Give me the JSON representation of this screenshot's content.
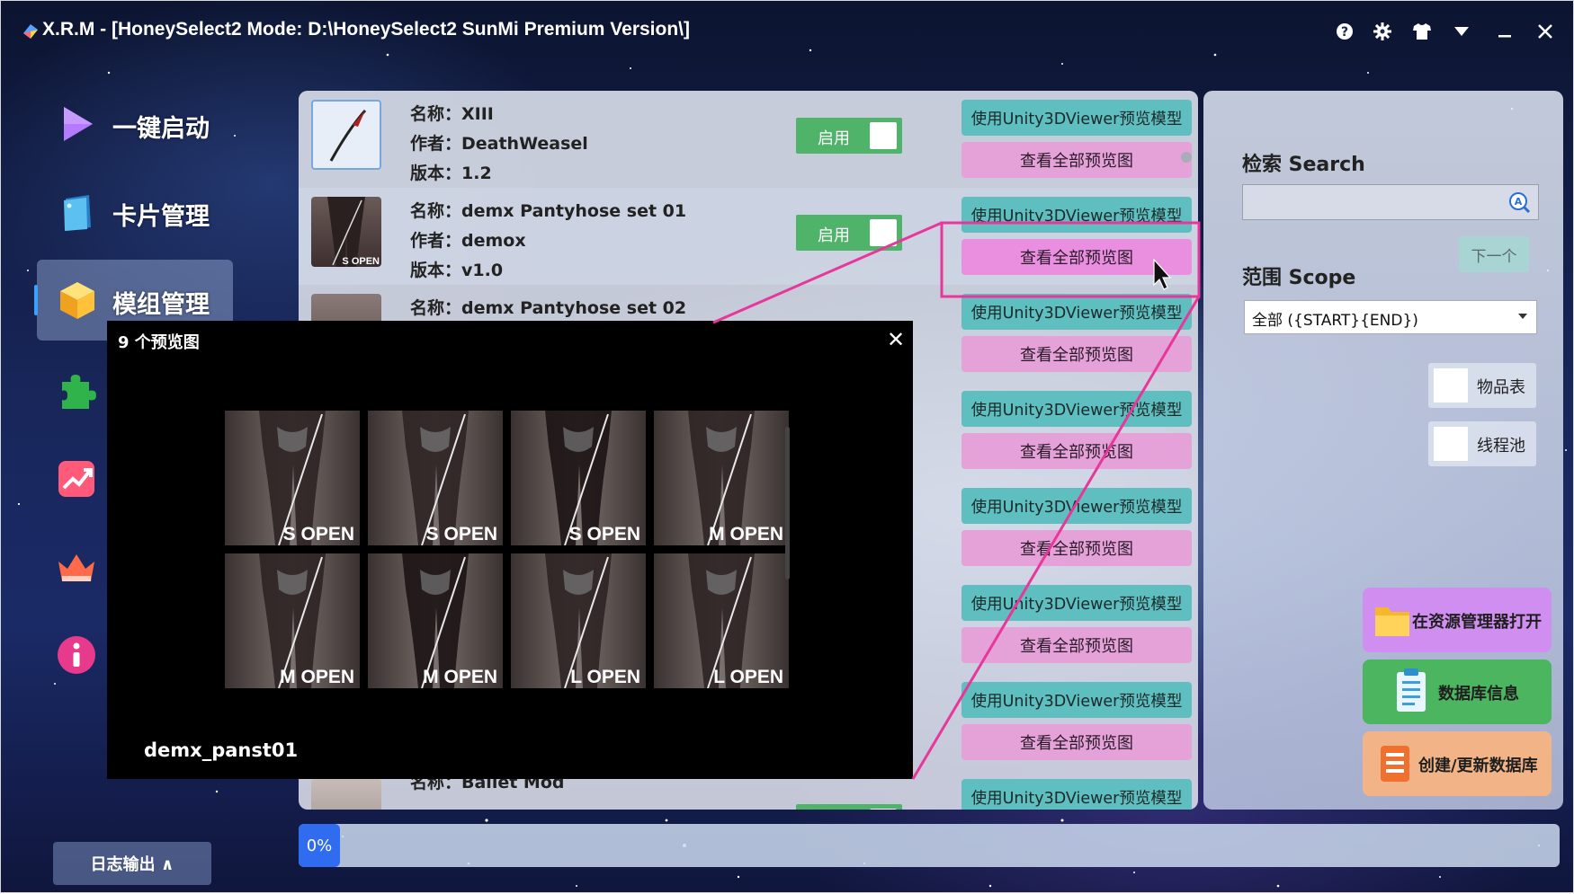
{
  "window": {
    "title": "X.R.M - [HoneySelect2 Mode: D:\\HoneySelect2 SunMi Premium Version\\]"
  },
  "sidebar": {
    "items": [
      {
        "label": "一键启动"
      },
      {
        "label": "卡片管理"
      },
      {
        "label": "模组管理"
      }
    ],
    "log_button": "日志输出 ∧"
  },
  "mods": [
    {
      "name": "名称：XIII",
      "author": "作者：DeathWeasel",
      "version": "版本：1.2",
      "toggle": "启用"
    },
    {
      "name": "名称：demx Pantyhose set 01",
      "author": "作者：demox",
      "version": "版本：v1.0",
      "toggle": "启用"
    },
    {
      "name": "名称：demx Pantyhose set 02",
      "author": "",
      "version": "",
      "toggle": ""
    },
    {
      "name": "名称：Ballet Mod",
      "author": "",
      "version": "",
      "toggle": ""
    }
  ],
  "row_buttons": {
    "unity": "使用Unity3DViewer预览模型",
    "preview": "查看全部预览图"
  },
  "search": {
    "label": "检索 Search",
    "value": "",
    "next": "下一个"
  },
  "scope": {
    "label": "范围 Scope",
    "selected": "全部 ({START}{END})"
  },
  "checkboxes": [
    {
      "label": "物品表",
      "checked": false
    },
    {
      "label": "线程池",
      "checked": false
    }
  ],
  "actions": {
    "open_explorer": "在资源管理器打开",
    "db_info": "数据库信息",
    "create_db": "创建/更新数据库"
  },
  "progress": {
    "percent": 0,
    "text": "0%"
  },
  "preview": {
    "title": "9 个预览图",
    "close": "✕",
    "name": "demx_panst01",
    "images": [
      "S OPEN",
      "S OPEN",
      "S OPEN",
      "M OPEN",
      "M OPEN",
      "M OPEN",
      "L OPEN",
      "L OPEN"
    ]
  },
  "thumb_label": "S OPEN",
  "colors": {
    "accent": "#3ba0ff",
    "toggle_on": "#4fb36a",
    "unity_button": "#5fbfc0",
    "preview_button": "#e5a2d9",
    "annotation": "#e8369a",
    "progress": "#2f6cf0"
  }
}
